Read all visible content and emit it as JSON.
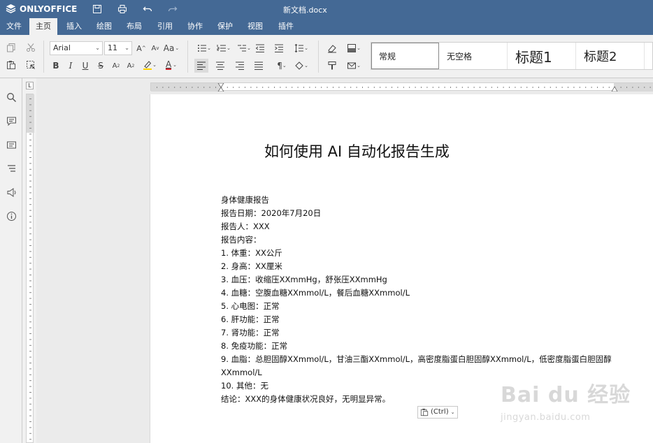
{
  "app": {
    "brand": "ONLYOFFICE",
    "doc_title": "新文档.docx"
  },
  "tabs": [
    "文件",
    "主页",
    "插入",
    "绘图",
    "布局",
    "引用",
    "协作",
    "保护",
    "视图",
    "插件"
  ],
  "active_tab": "主页",
  "toolbar": {
    "font_name": "Arial",
    "font_size": "11",
    "case_label": "Aa",
    "styles": [
      "常规",
      "无空格",
      "标题1",
      "标题2"
    ]
  },
  "document": {
    "heading": "如何使用 AI 自动化报告生成",
    "lines": [
      "身体健康报告",
      "报告日期：2020年7月20日",
      "报告人：XXX",
      "报告内容：",
      "1. 体重：XX公斤",
      "2. 身高：XX厘米",
      "3. 血压：收缩压XXmmHg，舒张压XXmmHg",
      "4. 血糖：空腹血糖XXmmol/L，餐后血糖XXmmol/L",
      "5. 心电图：正常",
      "6. 肝功能：正常",
      "7. 肾功能：正常",
      "8. 免疫功能：正常",
      "9. 血脂：总胆固醇XXmmol/L，甘油三酯XXmmol/L，高密度脂蛋白胆固醇XXmmol/L，低密度脂蛋白胆固醇XXmmol/L",
      "10. 其他：无",
      "结论：XXX的身体健康状况良好，无明显异常。"
    ]
  },
  "paste_button": "(Ctrl)",
  "ruler_corner": "L",
  "watermark": {
    "main": "Bai du 经验",
    "sub": "jingyan.baidu.com"
  },
  "colors": {
    "header": "#446995",
    "highlight": "#ffd400",
    "font_color": "#d9252f"
  }
}
